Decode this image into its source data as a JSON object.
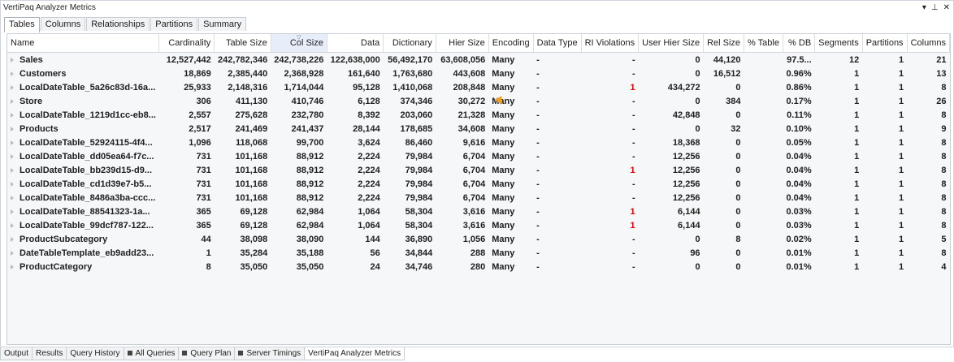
{
  "window": {
    "title": "VertiPaq Analyzer Metrics"
  },
  "title_controls": {
    "dropdown": "▾",
    "pin": "⊥",
    "close": "✕"
  },
  "tabs": [
    {
      "label": "Tables",
      "active": true
    },
    {
      "label": "Columns",
      "active": false
    },
    {
      "label": "Relationships",
      "active": false
    },
    {
      "label": "Partitions",
      "active": false
    },
    {
      "label": "Summary",
      "active": false
    }
  ],
  "columns": [
    {
      "key": "name",
      "label": "Name"
    },
    {
      "key": "cardinality",
      "label": "Cardinality"
    },
    {
      "key": "table_size",
      "label": "Table Size"
    },
    {
      "key": "col_size",
      "label": "Col Size"
    },
    {
      "key": "data",
      "label": "Data"
    },
    {
      "key": "dictionary",
      "label": "Dictionary"
    },
    {
      "key": "hier_size",
      "label": "Hier Size"
    },
    {
      "key": "encoding",
      "label": "Encoding"
    },
    {
      "key": "data_type",
      "label": "Data Type"
    },
    {
      "key": "ri_violations",
      "label": "RI Violations"
    },
    {
      "key": "user_hier_size",
      "label": "User Hier Size"
    },
    {
      "key": "rel_size",
      "label": "Rel Size"
    },
    {
      "key": "pct_table",
      "label": "% Table"
    },
    {
      "key": "pct_db",
      "label": "% DB"
    },
    {
      "key": "segments",
      "label": "Segments"
    },
    {
      "key": "partitions",
      "label": "Partitions"
    },
    {
      "key": "columns",
      "label": "Columns"
    }
  ],
  "rows": [
    {
      "name": "Sales",
      "cardinality": "12,527,442",
      "table_size": "242,782,346",
      "col_size": "242,738,226",
      "data": "122,638,000",
      "dictionary": "56,492,170",
      "hier_size": "63,608,056",
      "encoding": "Many",
      "data_type": "-",
      "ri_violations": "-",
      "user_hier_size": "0",
      "rel_size": "44,120",
      "pct_table": "",
      "pct_db": "97.5...",
      "segments": "12",
      "partitions": "1",
      "columns": "21"
    },
    {
      "name": "Customers",
      "cardinality": "18,869",
      "table_size": "2,385,440",
      "col_size": "2,368,928",
      "data": "161,640",
      "dictionary": "1,763,680",
      "hier_size": "443,608",
      "encoding": "Many",
      "data_type": "-",
      "ri_violations": "-",
      "user_hier_size": "0",
      "rel_size": "16,512",
      "pct_table": "",
      "pct_db": "0.96%",
      "segments": "1",
      "partitions": "1",
      "columns": "13"
    },
    {
      "name": "LocalDateTable_5a26c83d-16a...",
      "cardinality": "25,933",
      "table_size": "2,148,316",
      "col_size": "1,714,044",
      "data": "95,128",
      "dictionary": "1,410,068",
      "hier_size": "208,848",
      "encoding": "Many",
      "data_type": "-",
      "ri_violations": "1",
      "user_hier_size": "434,272",
      "rel_size": "0",
      "pct_table": "",
      "pct_db": "0.86%",
      "segments": "1",
      "partitions": "1",
      "columns": "8"
    },
    {
      "name": "Store",
      "cardinality": "306",
      "table_size": "411,130",
      "col_size": "410,746",
      "data": "6,128",
      "dictionary": "374,346",
      "hier_size": "30,272",
      "encoding": "Many",
      "data_type": "-",
      "ri_violations": "-",
      "user_hier_size": "0",
      "rel_size": "384",
      "pct_table": "",
      "pct_db": "0.17%",
      "segments": "1",
      "partitions": "1",
      "columns": "26"
    },
    {
      "name": "LocalDateTable_1219d1cc-eb8...",
      "cardinality": "2,557",
      "table_size": "275,628",
      "col_size": "232,780",
      "data": "8,392",
      "dictionary": "203,060",
      "hier_size": "21,328",
      "encoding": "Many",
      "data_type": "-",
      "ri_violations": "-",
      "user_hier_size": "42,848",
      "rel_size": "0",
      "pct_table": "",
      "pct_db": "0.11%",
      "segments": "1",
      "partitions": "1",
      "columns": "8"
    },
    {
      "name": "Products",
      "cardinality": "2,517",
      "table_size": "241,469",
      "col_size": "241,437",
      "data": "28,144",
      "dictionary": "178,685",
      "hier_size": "34,608",
      "encoding": "Many",
      "data_type": "-",
      "ri_violations": "-",
      "user_hier_size": "0",
      "rel_size": "32",
      "pct_table": "",
      "pct_db": "0.10%",
      "segments": "1",
      "partitions": "1",
      "columns": "9"
    },
    {
      "name": "LocalDateTable_52924115-4f4...",
      "cardinality": "1,096",
      "table_size": "118,068",
      "col_size": "99,700",
      "data": "3,624",
      "dictionary": "86,460",
      "hier_size": "9,616",
      "encoding": "Many",
      "data_type": "-",
      "ri_violations": "-",
      "user_hier_size": "18,368",
      "rel_size": "0",
      "pct_table": "",
      "pct_db": "0.05%",
      "segments": "1",
      "partitions": "1",
      "columns": "8"
    },
    {
      "name": "LocalDateTable_dd05ea64-f7c...",
      "cardinality": "731",
      "table_size": "101,168",
      "col_size": "88,912",
      "data": "2,224",
      "dictionary": "79,984",
      "hier_size": "6,704",
      "encoding": "Many",
      "data_type": "-",
      "ri_violations": "-",
      "user_hier_size": "12,256",
      "rel_size": "0",
      "pct_table": "",
      "pct_db": "0.04%",
      "segments": "1",
      "partitions": "1",
      "columns": "8"
    },
    {
      "name": "LocalDateTable_bb239d15-d9...",
      "cardinality": "731",
      "table_size": "101,168",
      "col_size": "88,912",
      "data": "2,224",
      "dictionary": "79,984",
      "hier_size": "6,704",
      "encoding": "Many",
      "data_type": "-",
      "ri_violations": "1",
      "user_hier_size": "12,256",
      "rel_size": "0",
      "pct_table": "",
      "pct_db": "0.04%",
      "segments": "1",
      "partitions": "1",
      "columns": "8"
    },
    {
      "name": "LocalDateTable_cd1d39e7-b5...",
      "cardinality": "731",
      "table_size": "101,168",
      "col_size": "88,912",
      "data": "2,224",
      "dictionary": "79,984",
      "hier_size": "6,704",
      "encoding": "Many",
      "data_type": "-",
      "ri_violations": "-",
      "user_hier_size": "12,256",
      "rel_size": "0",
      "pct_table": "",
      "pct_db": "0.04%",
      "segments": "1",
      "partitions": "1",
      "columns": "8"
    },
    {
      "name": "LocalDateTable_8486a3ba-ccc...",
      "cardinality": "731",
      "table_size": "101,168",
      "col_size": "88,912",
      "data": "2,224",
      "dictionary": "79,984",
      "hier_size": "6,704",
      "encoding": "Many",
      "data_type": "-",
      "ri_violations": "-",
      "user_hier_size": "12,256",
      "rel_size": "0",
      "pct_table": "",
      "pct_db": "0.04%",
      "segments": "1",
      "partitions": "1",
      "columns": "8"
    },
    {
      "name": "LocalDateTable_88541323-1a...",
      "cardinality": "365",
      "table_size": "69,128",
      "col_size": "62,984",
      "data": "1,064",
      "dictionary": "58,304",
      "hier_size": "3,616",
      "encoding": "Many",
      "data_type": "-",
      "ri_violations": "1",
      "user_hier_size": "6,144",
      "rel_size": "0",
      "pct_table": "",
      "pct_db": "0.03%",
      "segments": "1",
      "partitions": "1",
      "columns": "8"
    },
    {
      "name": "LocalDateTable_99dcf787-122...",
      "cardinality": "365",
      "table_size": "69,128",
      "col_size": "62,984",
      "data": "1,064",
      "dictionary": "58,304",
      "hier_size": "3,616",
      "encoding": "Many",
      "data_type": "-",
      "ri_violations": "1",
      "user_hier_size": "6,144",
      "rel_size": "0",
      "pct_table": "",
      "pct_db": "0.03%",
      "segments": "1",
      "partitions": "1",
      "columns": "8"
    },
    {
      "name": "ProductSubcategory",
      "cardinality": "44",
      "table_size": "38,098",
      "col_size": "38,090",
      "data": "144",
      "dictionary": "36,890",
      "hier_size": "1,056",
      "encoding": "Many",
      "data_type": "-",
      "ri_violations": "-",
      "user_hier_size": "0",
      "rel_size": "8",
      "pct_table": "",
      "pct_db": "0.02%",
      "segments": "1",
      "partitions": "1",
      "columns": "5"
    },
    {
      "name": "DateTableTemplate_eb9add23...",
      "cardinality": "1",
      "table_size": "35,284",
      "col_size": "35,188",
      "data": "56",
      "dictionary": "34,844",
      "hier_size": "288",
      "encoding": "Many",
      "data_type": "-",
      "ri_violations": "-",
      "user_hier_size": "96",
      "rel_size": "0",
      "pct_table": "",
      "pct_db": "0.01%",
      "segments": "1",
      "partitions": "1",
      "columns": "8"
    },
    {
      "name": "ProductCategory",
      "cardinality": "8",
      "table_size": "35,050",
      "col_size": "35,050",
      "data": "24",
      "dictionary": "34,746",
      "hier_size": "280",
      "encoding": "Many",
      "data_type": "-",
      "ri_violations": "-",
      "user_hier_size": "0",
      "rel_size": "0",
      "pct_table": "",
      "pct_db": "0.01%",
      "segments": "1",
      "partitions": "1",
      "columns": "4"
    }
  ],
  "bottom_tabs": [
    {
      "label": "Output",
      "icon": false,
      "active": false
    },
    {
      "label": "Results",
      "icon": false,
      "active": false
    },
    {
      "label": "Query History",
      "icon": false,
      "active": false
    },
    {
      "label": "All Queries",
      "icon": true,
      "active": false
    },
    {
      "label": "Query Plan",
      "icon": true,
      "active": false
    },
    {
      "label": "Server Timings",
      "icon": true,
      "active": false
    },
    {
      "label": "VertiPaq Analyzer Metrics",
      "icon": false,
      "active": true
    }
  ],
  "colors": {
    "ri_violation": "#e00000",
    "sorted_header": "#e7eefa"
  }
}
